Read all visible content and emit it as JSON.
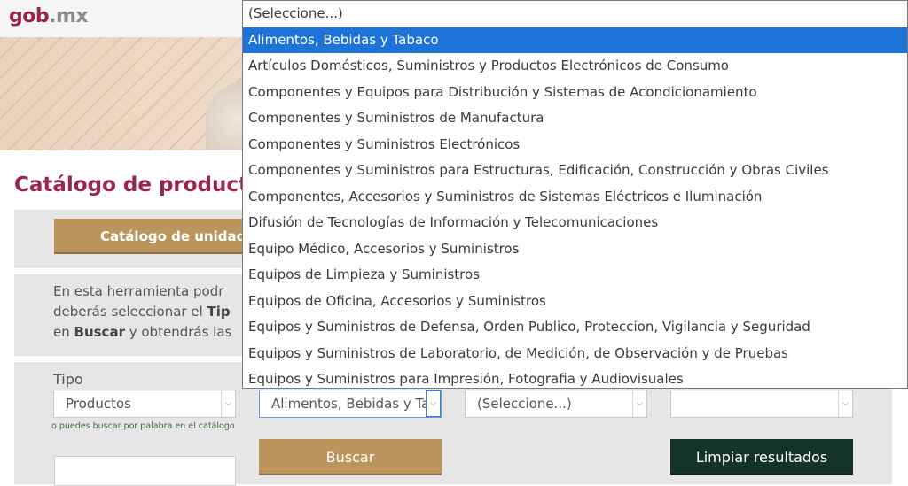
{
  "header": {
    "logo_main": "gob",
    "logo_tld": ".mx"
  },
  "page": {
    "title": "Catálogo de productos",
    "tab_button": "Catálogo de unidade"
  },
  "description": {
    "line1": "En esta herramienta podr",
    "line2_prefix": "deberás seleccionar el ",
    "line2_bold": "Tip",
    "line3_prefix": "en ",
    "line3_bold": "Buscar",
    "line3_suffix": " y obtendrás las"
  },
  "form": {
    "tipo_label": "Tipo",
    "tipo_value": "Productos",
    "hint": "o puedes buscar por palabra en el catálogo",
    "segment_value": "Alimentos, Bebidas y Tabaco",
    "family_value": "(Seleccione...)",
    "class_value": "",
    "search_button": "Buscar",
    "clear_button": "Limpiar resultados"
  },
  "dropdown": {
    "options": [
      "(Seleccione...)",
      "Alimentos, Bebidas y Tabaco",
      "Artículos Domésticos, Suministros y Productos Electrónicos de Consumo",
      "Componentes y Equipos para Distribución y Sistemas de Acondicionamiento",
      "Componentes y Suministros de Manufactura",
      "Componentes y Suministros Electrónicos",
      "Componentes y Suministros para Estructuras, Edificación, Construcción y Obras Civiles",
      "Componentes, Accesorios y Suministros de Sistemas Eléctricos e Iluminación",
      "Difusión de Tecnologías de Información y Telecomunicaciones",
      "Equipo Médico, Accesorios y Suministros",
      "Equipos de Limpieza y Suministros",
      "Equipos de Oficina, Accesorios y Suministros",
      "Equipos y Suministros de Defensa, Orden Publico, Proteccion, Vigilancia y Seguridad",
      "Equipos y Suministros de Laboratorio, de Medición, de Observación y de Pruebas",
      "Equipos y Suministros para Impresión, Fotografia y Audiovisuales"
    ],
    "selected_index": 1
  },
  "colors": {
    "brand": "#9d2449",
    "accent_gold": "#bc955c",
    "dark_green": "#14332b",
    "selection_blue": "#1e73d8"
  }
}
